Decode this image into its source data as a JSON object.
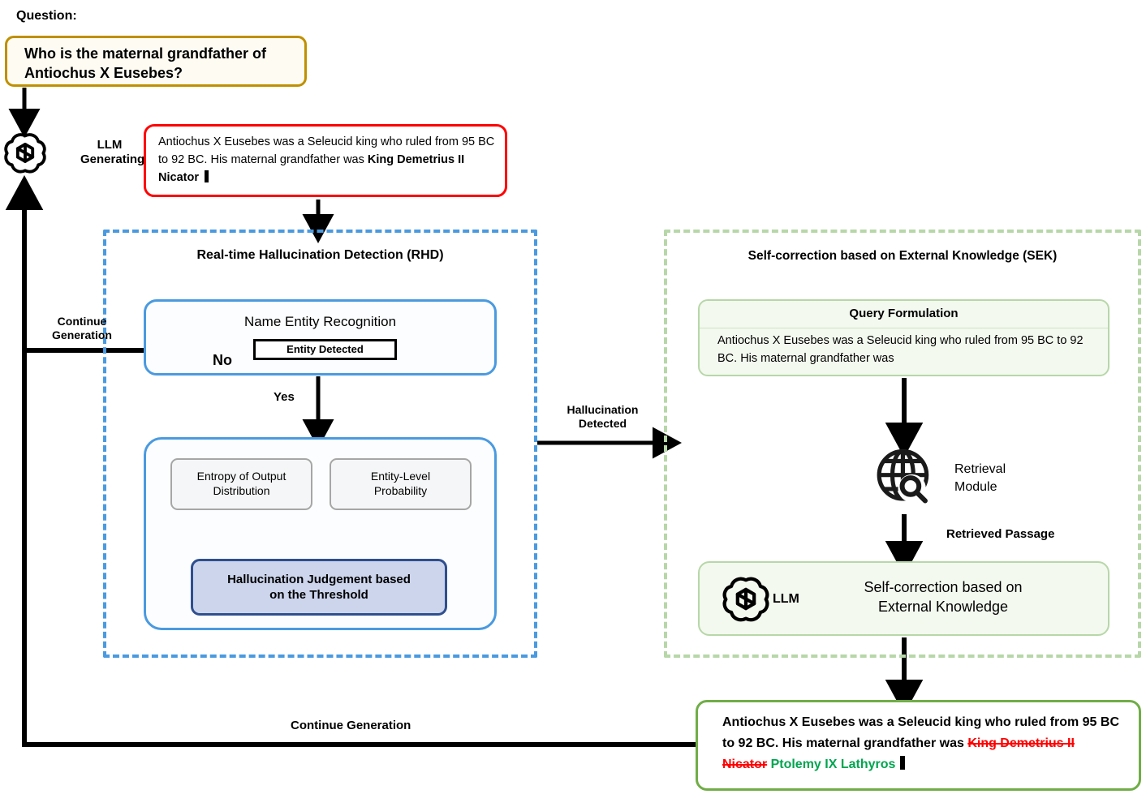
{
  "question": {
    "title": "Question:",
    "text": "Who is the maternal grandfather of Antiochus X Eusebes?"
  },
  "llm_generation": {
    "label": "LLM\nGenerating:",
    "label_line1": "LLM",
    "label_line2": "Generating:",
    "plain_text": "Antiochus X Eusebes was a Seleucid king who ruled from 95 BC to 92 BC. His maternal grandfather was",
    "bold_entity": "King Demetrius II Nicator",
    "border_color": "#ff0000"
  },
  "rhd": {
    "title": "Real-time Hallucination Detection (RHD)",
    "border_color": "#4a9ae0",
    "ner": {
      "title": "Name Entity Recognition",
      "decision_label": "Entity Detected",
      "no_label": "No",
      "yes_label": "Yes"
    },
    "signals": [
      {
        "label_line1": "Entropy of Output",
        "label_line2": "Distribution"
      },
      {
        "label_line1": "Entity-Level",
        "label_line2": "Probability"
      }
    ],
    "judgement": {
      "line1": "Hallucination Judgement based",
      "line2": "on the Threshold",
      "fill_color": "#ccd5ec",
      "border_color": "#2f4f8f"
    }
  },
  "sek": {
    "title": "Self-correction based on External Knowledge (SEK)",
    "border_color": "#b7d7a8",
    "query_formulation": {
      "header": "Query Formulation",
      "text": "Antiochus X Eusebes was a Seleucid king who ruled from 95 BC to 92 BC. His maternal grandfather was"
    },
    "retrieval": {
      "icon": "globe-search-icon",
      "label_line1": "Retrieval",
      "label_line2": "Module",
      "output_label": "Retrieved Passage"
    },
    "self_correction": {
      "llm_icon": "openai-logo-icon",
      "llm_label": "LLM",
      "line1": "Self-correction based on",
      "line2": "External Knowledge"
    }
  },
  "final_answer": {
    "plain_text": "Antiochus X Eusebes was a Seleucid king who ruled from 95 BC to 92 BC. His maternal grandfather was",
    "removed_entity": "King Demetrius II Nicator",
    "corrected_entity": "Ptolemy IX Lathyros",
    "border_color": "#70ad47",
    "removed_color": "#ff0000",
    "corrected_color": "#00a550"
  },
  "flow_labels": {
    "continue_generation_left_line1": "Continue",
    "continue_generation_left_line2": "Generation",
    "hallucination_detected_line1": "Hallucination",
    "hallucination_detected_line2": "Detected",
    "continue_generation_bottom": "Continue Generation"
  },
  "icons": {
    "llm_left": "openai-logo-icon"
  }
}
